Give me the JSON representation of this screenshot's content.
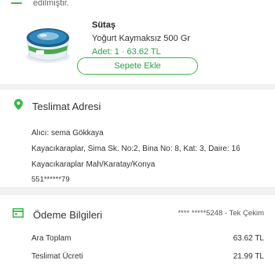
{
  "product": {
    "status_text": "edilmiştir.",
    "brand": "Sütaş",
    "name": "Yoğurt Kaymaksız 500 Gr",
    "quantity": "Adet: 1",
    "separator": "·",
    "price": "63.62 TL",
    "add_to_cart_label": "Sepete Ekle",
    "accent_color": "#3bb54a"
  },
  "address": {
    "title": "Teslimat Adresi",
    "recipient": "Alıcı: sema Gökkaya",
    "line1": "Kayacıkaraplar,  Sima Sk. No:2, Bina No: 8, Kat: 3, Daire: 16",
    "line2": "Kayacıkaraplar Mah/Karatay/Konya",
    "phone": "551******79",
    "icon": "location-pin-icon"
  },
  "payment": {
    "title": "Ödeme Bilgileri",
    "card_info": "**** *****5248 - Tek Çekim",
    "icon": "card-icon",
    "rows": [
      {
        "label": "Ara Toplam",
        "value": "63.62 TL"
      },
      {
        "label": "Teslimat Ücreti",
        "value": "21.99 TL"
      }
    ]
  }
}
